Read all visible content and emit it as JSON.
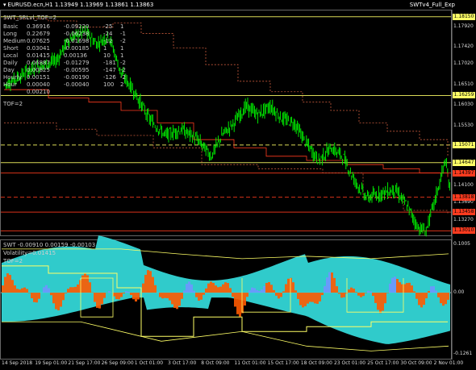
{
  "header": {
    "symbol_line": "EURUSD.ecn,H1  1.13949 1.13969 1.13861 1.13863",
    "preset": "SWTv4_Full_Exp"
  },
  "price_panel": {
    "indicator_title": "SWT_SRLvl_TOF=2",
    "tof_label": "TOF=2",
    "table": [
      {
        "name": "Basic",
        "v1": "0.36916",
        "v2": "-0.09220",
        "v3": "-25",
        "v4": "1"
      },
      {
        "name": "Long",
        "v1": "0.22679",
        "v2": "-0.06238",
        "v3": "-24",
        "v4": "-1"
      },
      {
        "name": "Medium",
        "v1": "0.07625",
        "v2": "-0.01698",
        "v3": "-12",
        "v4": "-2"
      },
      {
        "name": "Short",
        "v1": "0.03041",
        "v2": "-0.00185",
        "v3": "1",
        "v4": "1"
      },
      {
        "name": "Local",
        "v1": "0.01415",
        "v2": "0.00136",
        "v3": "10",
        "v4": "1"
      },
      {
        "name": "Daily",
        "v1": "0.06887",
        "v2": "-0.01279",
        "v3": "-181",
        "v4": "-2"
      },
      {
        "name": "Day",
        "v1": "0.00825",
        "v2": "-0.00595",
        "v3": "-147",
        "v4": "-2"
      },
      {
        "name": "Hourly",
        "v1": "0.00151",
        "v2": "-0.00190",
        "v3": "-126",
        "v4": "-2"
      },
      {
        "name": "Hour",
        "v1": "0.00040",
        "v2": "-0.00040",
        "v3": "100",
        "v4": "2"
      },
      {
        "name": "",
        "v1": "0.00210",
        "v2": "",
        "v3": "",
        "v4": ""
      }
    ],
    "axis_ticks": [
      {
        "label": "1.17920",
        "price": 1.1792
      },
      {
        "label": "1.17420",
        "price": 1.1742
      },
      {
        "label": "1.17020",
        "price": 1.1702
      },
      {
        "label": "1.16510",
        "price": 1.1651
      },
      {
        "label": "1.16030",
        "price": 1.1603
      },
      {
        "label": "1.15530",
        "price": 1.1553
      },
      {
        "label": "1.14100",
        "price": 1.141
      },
      {
        "label": "1.13690",
        "price": 1.1369
      },
      {
        "label": "1.13270",
        "price": 1.1327
      }
    ],
    "price_labels": [
      {
        "label": "1.18150",
        "price": 1.1815,
        "color": "#ffff66"
      },
      {
        "label": "1.16259",
        "price": 1.16259,
        "color": "#ffff66"
      },
      {
        "label": "1.15071",
        "price": 1.15071,
        "color": "#ffff66"
      },
      {
        "label": "1.14647",
        "price": 1.14647,
        "color": "#ffff66"
      },
      {
        "label": "1.14397",
        "price": 1.14397,
        "color": "#ff3b1f"
      },
      {
        "label": "1.13818",
        "price": 1.13818,
        "color": "#ff3b1f"
      },
      {
        "label": "1.13458",
        "price": 1.13458,
        "color": "#ff3b1f"
      },
      {
        "label": "1.13010",
        "price": 1.1301,
        "color": "#ff3b1f"
      }
    ]
  },
  "indicator_panel": {
    "title": "SWT -0.00910 0.00159 -0.00103",
    "volatility_label": "Volatility=0.01415",
    "tof_label": "TOF=2",
    "axis_ticks": [
      {
        "label": "0.1005",
        "value": 0.1005
      },
      {
        "label": "0.00",
        "value": 0.0
      },
      {
        "label": "-0.1261",
        "value": -0.1261
      }
    ]
  },
  "date_axis": [
    "14 Sep 2018",
    "19 Sep 01:00",
    "21 Sep 17:00",
    "26 Sep 09:00",
    "1 Oct 01:00",
    "3 Oct 17:00",
    "8 Oct 09:00",
    "11 Oct 01:00",
    "15 Oct 17:00",
    "18 Oct 09:00",
    "23 Oct 01:00",
    "25 Oct 17:00",
    "30 Oct 09:00",
    "2 Nov 01:00"
  ],
  "colors": {
    "candles": "#00ff00",
    "support": "#ff3b1f",
    "resist_dotted": "#c85a3c",
    "level_yellow": "#ffff66",
    "cyan_fill": "#33d6d6",
    "orange_fill": "#ff5a00",
    "blue_fill": "#6f96ff"
  }
}
